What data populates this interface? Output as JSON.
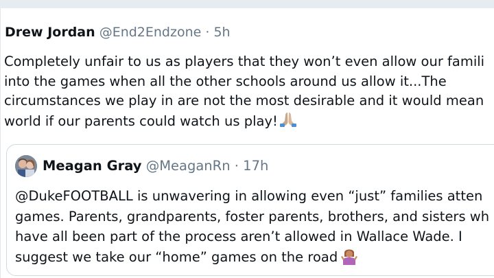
{
  "tweet": {
    "author_name": "Drew Jordan",
    "author_handle": "@End2Endzone",
    "separator": "·",
    "time": "5h",
    "lines": [
      "Completely unfair to us as players that they won’t even allow our famili",
      "into the games when all the other schools around us allow it...The",
      "circumstances we play in are not the most desirable and it would mean",
      "world if our parents could watch us play!"
    ],
    "trailing_emoji": "folded-hands-icon"
  },
  "quoted_tweet": {
    "author_name": "Meagan Gray",
    "author_handle": "@MeaganRn",
    "separator": "·",
    "time": "17h",
    "lines": [
      "@DukeFOOTBALL is unwavering in allowing even “just” families atten",
      "games. Parents, grandparents, foster parents, brothers, and sisters wh",
      "have all been part of the process aren’t allowed in Wallace Wade. I",
      "suggest we take our “home” games on the road"
    ],
    "trailing_emoji": "person-shrugging-icon"
  }
}
